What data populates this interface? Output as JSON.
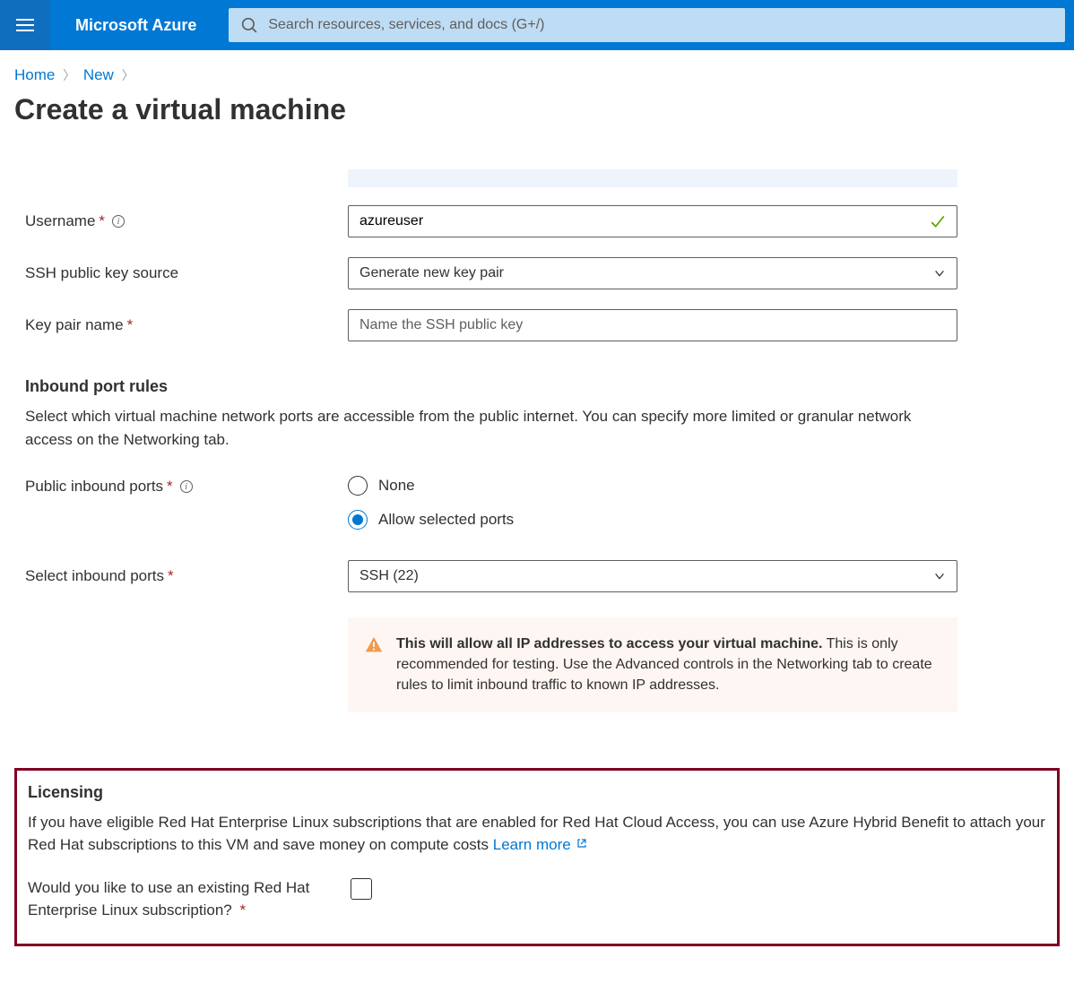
{
  "header": {
    "brand": "Microsoft Azure",
    "search_placeholder": "Search resources, services, and docs (G+/)"
  },
  "breadcrumb": {
    "home": "Home",
    "new": "New"
  },
  "page_title": "Create a virtual machine",
  "form": {
    "username_label": "Username",
    "username_value": "azureuser",
    "ssh_source_label": "SSH public key source",
    "ssh_source_value": "Generate new key pair",
    "keypair_label": "Key pair name",
    "keypair_placeholder": "Name the SSH public key"
  },
  "inbound": {
    "heading": "Inbound port rules",
    "description": "Select which virtual machine network ports are accessible from the public internet. You can specify more limited or granular network access on the Networking tab.",
    "public_ports_label": "Public inbound ports",
    "radio_none": "None",
    "radio_allow": "Allow selected ports",
    "select_ports_label": "Select inbound ports",
    "select_ports_value": "SSH (22)",
    "warning_strong": "This will allow all IP addresses to access your virtual machine.",
    "warning_rest": "  This is only recommended for testing.  Use the Advanced controls in the Networking tab to create rules to limit inbound traffic to known IP addresses."
  },
  "licensing": {
    "heading": "Licensing",
    "desc_part1": "If you have eligible Red Hat Enterprise Linux subscriptions that are enabled for Red Hat Cloud Access, you can use Azure Hybrid Benefit to attach your Red Hat subscriptions to this VM and save money on compute costs  ",
    "learn_more": "Learn more",
    "question": "Would you like to use an existing Red Hat Enterprise Linux subscription?"
  }
}
